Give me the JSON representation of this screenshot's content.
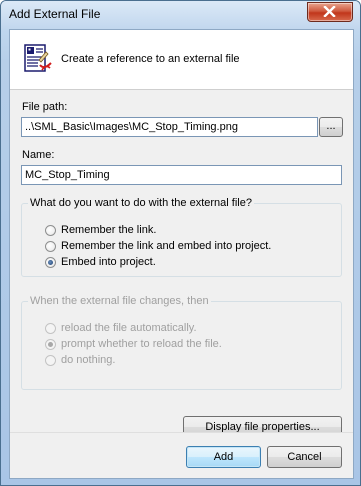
{
  "window": {
    "title": "Add External File"
  },
  "header": {
    "description": "Create a reference to an external file"
  },
  "file_path": {
    "label": "File path:",
    "value": "..\\SML_Basic\\Images\\MC_Stop_Timing.png",
    "browse_label": "..."
  },
  "name": {
    "label": "Name:",
    "value": "MC_Stop_Timing"
  },
  "action_group": {
    "legend": "What do you want to do with the external file?",
    "options": [
      {
        "label": "Remember the link.",
        "checked": false
      },
      {
        "label": "Remember the link and embed into project.",
        "checked": false
      },
      {
        "label": "Embed into project.",
        "checked": true
      }
    ]
  },
  "change_group": {
    "legend": "When the external file changes, then",
    "enabled": false,
    "options": [
      {
        "label": "reload the file automatically.",
        "checked": false
      },
      {
        "label": "prompt whether to reload the file.",
        "checked": true
      },
      {
        "label": "do nothing.",
        "checked": false
      }
    ]
  },
  "buttons": {
    "display_properties": "Display file properties...",
    "add": "Add",
    "cancel": "Cancel"
  },
  "colors": {
    "title_bar": "#c2d7ee",
    "close_button": "#c1361b",
    "dialog_bg": "#f0f0f0",
    "default_button_border": "#3c7fb1"
  }
}
